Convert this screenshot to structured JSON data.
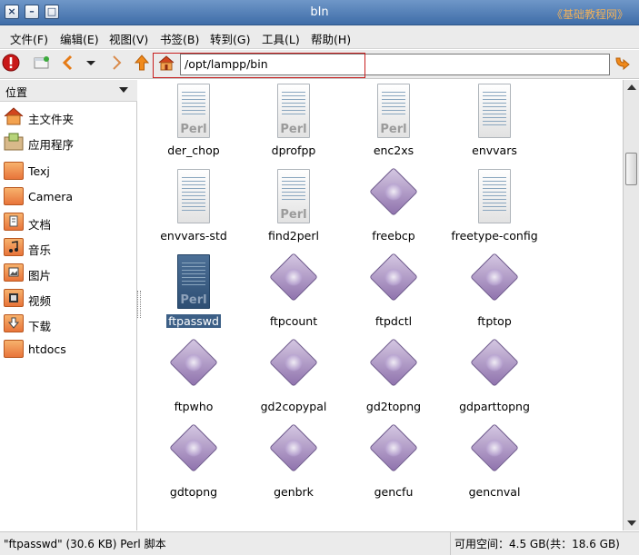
{
  "window": {
    "title": "bIn",
    "watermark": "《基础教程网》"
  },
  "menubar": [
    "文件(F)",
    "编辑(E)",
    "视图(V)",
    "书签(B)",
    "转到(G)",
    "工具(L)",
    "帮助(H)"
  ],
  "toolbar": {
    "icons": [
      "stop-icon",
      "new-tab-icon",
      "back-icon",
      "history-dropdown-icon",
      "forward-icon",
      "up-icon",
      "home-icon",
      "go-icon"
    ]
  },
  "location": {
    "path": "/opt/lampp/bin"
  },
  "sidebar": {
    "header": "位置",
    "items": [
      {
        "label": "主文件夹",
        "icon": "home-folder-icon"
      },
      {
        "label": "应用程序",
        "icon": "applications-folder-icon"
      },
      {
        "label": "Texj",
        "icon": "folder-icon"
      },
      {
        "label": "Camera",
        "icon": "folder-icon"
      },
      {
        "label": "文档",
        "icon": "documents-folder-icon"
      },
      {
        "label": "音乐",
        "icon": "music-folder-icon"
      },
      {
        "label": "图片",
        "icon": "pictures-folder-icon"
      },
      {
        "label": "视频",
        "icon": "videos-folder-icon"
      },
      {
        "label": "下载",
        "icon": "downloads-folder-icon"
      },
      {
        "label": "htdocs",
        "icon": "folder-icon"
      }
    ]
  },
  "files": [
    {
      "name": "der_chop",
      "type": "perl"
    },
    {
      "name": "dprofpp",
      "type": "perl"
    },
    {
      "name": "enc2xs",
      "type": "perl"
    },
    {
      "name": "envvars",
      "type": "text"
    },
    {
      "name": "envvars-std",
      "type": "text"
    },
    {
      "name": "find2perl",
      "type": "perl"
    },
    {
      "name": "freebcp",
      "type": "exec"
    },
    {
      "name": "freetype-config",
      "type": "text"
    },
    {
      "name": "ftpasswd",
      "type": "perl",
      "selected": true
    },
    {
      "name": "ftpcount",
      "type": "exec"
    },
    {
      "name": "ftpdctl",
      "type": "exec"
    },
    {
      "name": "ftptop",
      "type": "exec"
    },
    {
      "name": "ftpwho",
      "type": "exec"
    },
    {
      "name": "gd2copypal",
      "type": "exec"
    },
    {
      "name": "gd2topng",
      "type": "exec"
    },
    {
      "name": "gdparttopng",
      "type": "exec"
    },
    {
      "name": "gdtopng",
      "type": "exec"
    },
    {
      "name": "genbrk",
      "type": "exec"
    },
    {
      "name": "gencfu",
      "type": "exec"
    },
    {
      "name": "gencnval",
      "type": "exec"
    }
  ],
  "status": {
    "left": "\"ftpasswd\" (30.6 KB) Perl 脚本",
    "right": "可用空间：4.5 GB(共：18.6 GB)"
  }
}
